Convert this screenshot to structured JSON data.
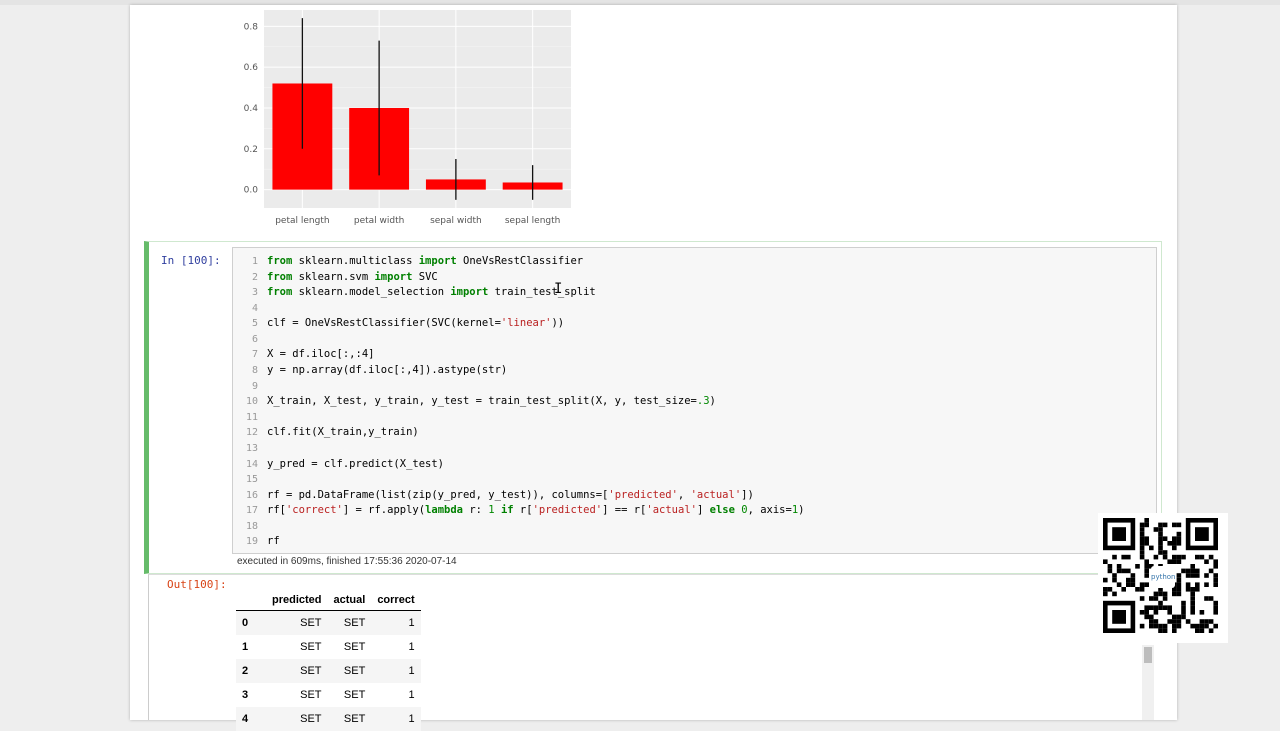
{
  "chart_data": {
    "type": "bar",
    "categories": [
      "petal length",
      "petal width",
      "sepal width",
      "sepal length"
    ],
    "values": [
      0.52,
      0.4,
      0.05,
      0.035
    ],
    "error_low": [
      0.2,
      0.07,
      -0.05,
      -0.05
    ],
    "error_high": [
      0.84,
      0.73,
      0.15,
      0.12
    ],
    "ylim": [
      -0.09,
      0.88
    ],
    "yticks": [
      "0.0",
      "0.2",
      "0.4",
      "0.6",
      "0.8"
    ],
    "ytick_values": [
      0,
      0.2,
      0.4,
      0.6,
      0.8
    ],
    "bar_color": "#ff0000",
    "background": "#ebebeb",
    "grid": true
  },
  "cell_in": {
    "prompt": "In [100]:",
    "lines": [
      [
        {
          "t": "from",
          "c": "kw"
        },
        {
          "t": " sklearn.multiclass "
        },
        {
          "t": "import",
          "c": "kw"
        },
        {
          "t": " OneVsRestClassifier"
        }
      ],
      [
        {
          "t": "from",
          "c": "kw"
        },
        {
          "t": " sklearn.svm "
        },
        {
          "t": "import",
          "c": "kw"
        },
        {
          "t": " SVC"
        }
      ],
      [
        {
          "t": "from",
          "c": "kw"
        },
        {
          "t": " sklearn.model_selection "
        },
        {
          "t": "import",
          "c": "kw"
        },
        {
          "t": " train_test_split"
        }
      ],
      [],
      [
        {
          "t": "clf = OneVsRestClassifier(SVC(kernel="
        },
        {
          "t": "'linear'",
          "c": "str"
        },
        {
          "t": "))"
        }
      ],
      [],
      [
        {
          "t": "X = df.iloc[:,:4]"
        }
      ],
      [
        {
          "t": "y = np.array(df.iloc[:,4]).astype(str)"
        }
      ],
      [],
      [
        {
          "t": "X_train, X_test, y_train, y_test = train_test_split(X, y, test_size="
        },
        {
          "t": ".3",
          "c": "num"
        },
        {
          "t": ")"
        }
      ],
      [],
      [
        {
          "t": "clf.fit(X_train,y_train)"
        }
      ],
      [],
      [
        {
          "t": "y_pred = clf.predict(X_test)"
        }
      ],
      [],
      [
        {
          "t": "rf = pd.DataFrame(list(zip(y_pred, y_test)), columns=["
        },
        {
          "t": "'predicted'",
          "c": "str"
        },
        {
          "t": ", "
        },
        {
          "t": "'actual'",
          "c": "str"
        },
        {
          "t": "])"
        }
      ],
      [
        {
          "t": "rf["
        },
        {
          "t": "'correct'",
          "c": "str"
        },
        {
          "t": "] = rf.apply("
        },
        {
          "t": "lambda",
          "c": "kw"
        },
        {
          "t": " r: "
        },
        {
          "t": "1",
          "c": "num"
        },
        {
          "t": " "
        },
        {
          "t": "if",
          "c": "kw"
        },
        {
          "t": " r["
        },
        {
          "t": "'predicted'",
          "c": "str"
        },
        {
          "t": "] == r["
        },
        {
          "t": "'actual'",
          "c": "str"
        },
        {
          "t": "] "
        },
        {
          "t": "else",
          "c": "kw"
        },
        {
          "t": " "
        },
        {
          "t": "0",
          "c": "num"
        },
        {
          "t": ", axis="
        },
        {
          "t": "1",
          "c": "num"
        },
        {
          "t": ")"
        }
      ],
      [],
      [
        {
          "t": "rf"
        }
      ]
    ],
    "exec_info": "executed in 609ms, finished 17:55:36 2020-07-14"
  },
  "cell_out": {
    "prompt": "Out[100]:",
    "columns": [
      "",
      "predicted",
      "actual",
      "correct"
    ],
    "rows": [
      [
        "0",
        "SET",
        "SET",
        "1"
      ],
      [
        "1",
        "SET",
        "SET",
        "1"
      ],
      [
        "2",
        "SET",
        "SET",
        "1"
      ],
      [
        "3",
        "SET",
        "SET",
        "1"
      ],
      [
        "4",
        "SET",
        "SET",
        "1"
      ]
    ]
  },
  "qr": {
    "logo_text": "python"
  }
}
